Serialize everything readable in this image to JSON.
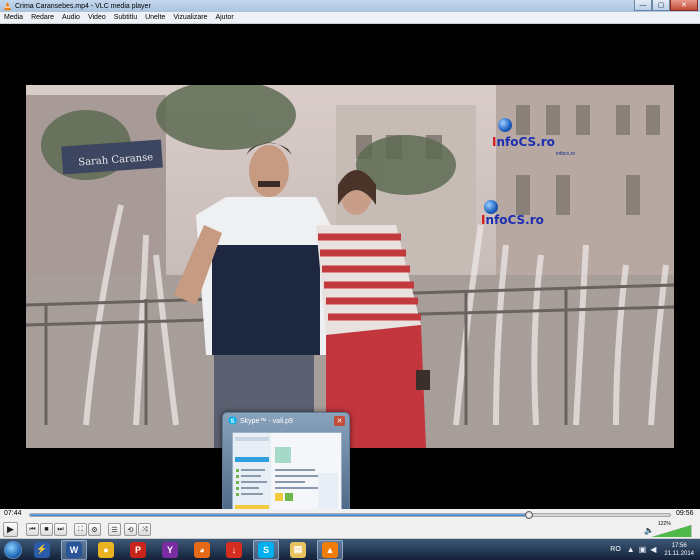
{
  "window": {
    "title": "Crima Caransebes.mp4 - VLC media player",
    "minimize_glyph": "—",
    "maximize_glyph": "▢",
    "close_glyph": "✕"
  },
  "menu": [
    "Media",
    "Redare",
    "Audio",
    "Video",
    "Subtitlu",
    "Unelte",
    "Vizualizare",
    "Ajutor"
  ],
  "video": {
    "watermark_top": {
      "prefix": "I",
      "text": "nfoCS.ro",
      "tagline": "infocs.ro"
    },
    "watermark_bottom": {
      "prefix": "I",
      "text": "nfoCS.ro"
    },
    "sign_text": "Sarah Caranse"
  },
  "thumbnail_popup": {
    "title": "Skype™ - vali.p9",
    "close_glyph": "✕",
    "icons": [
      {
        "name": "skype-home-icon",
        "color": "#4caf50"
      },
      {
        "name": "skype-contacts-icon",
        "color": "#f6c343"
      },
      {
        "name": "skype-call-icon",
        "color": "#e53935"
      },
      {
        "name": "skype-video-icon",
        "color": "#ffffff"
      }
    ]
  },
  "playback": {
    "elapsed": "07:44",
    "total": "09:56",
    "progress": 0.779
  },
  "controls": {
    "play": "▶",
    "prev": "⏮",
    "stop": "■",
    "next": "⏭",
    "fullscreen": "⛶",
    "extended": "⚙",
    "playlist": "☰",
    "loop": "⟲",
    "random": "⤨",
    "volume_label": "122%",
    "volume_icon": "🔈",
    "volume_level": 1.22
  },
  "taskbar": {
    "apps": [
      {
        "name": "flashget-icon",
        "glyph": "⚡",
        "color": "#2b5aa8",
        "active": false
      },
      {
        "name": "word-icon",
        "glyph": "W",
        "color": "#2a5699",
        "active": true
      },
      {
        "name": "chrome-icon",
        "glyph": "●",
        "color": "#e8b321",
        "active": false
      },
      {
        "name": "pdf-icon",
        "glyph": "P",
        "color": "#c8241b",
        "active": false
      },
      {
        "name": "yahoo-messenger-icon",
        "glyph": "Y",
        "color": "#7b2ca3",
        "active": false
      },
      {
        "name": "firefox-icon",
        "glyph": "◕",
        "color": "#e66a15",
        "active": false
      },
      {
        "name": "downloader-icon",
        "glyph": "↓",
        "color": "#d52d20",
        "active": false
      },
      {
        "name": "skype-icon",
        "glyph": "S",
        "color": "#00aff0",
        "active": true
      },
      {
        "name": "folder-icon",
        "glyph": "▤",
        "color": "#e6c15d",
        "active": false
      },
      {
        "name": "vlc-icon",
        "glyph": "▲",
        "color": "#f07c0a",
        "active": true
      }
    ],
    "language": "RO",
    "time": "17:56",
    "date": "21.11.2014"
  }
}
